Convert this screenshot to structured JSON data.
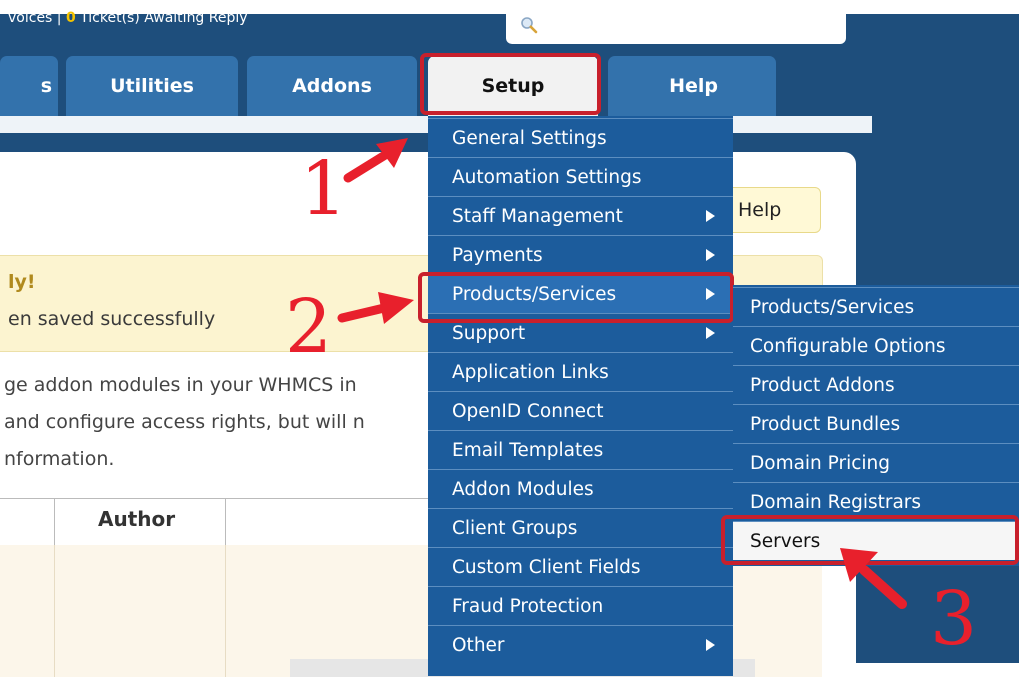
{
  "topbar": {
    "invoices_fragment": "voices | ",
    "tickets_count": "0",
    "tickets_text": " Ticket(s) Awaiting Reply"
  },
  "nav": {
    "tabs": [
      {
        "label": "s"
      },
      {
        "label": "Utilities"
      },
      {
        "label": "Addons"
      },
      {
        "label": "Setup"
      },
      {
        "label": "Help"
      }
    ]
  },
  "content": {
    "help_label": "Help",
    "success_title": "ly!",
    "success_message": "en saved successfully",
    "description_lines": [
      "ge addon modules in your WHMCS in",
      "and configure access rights, but will n",
      "nformation."
    ],
    "table_headers": {
      "author": "Author"
    }
  },
  "setup_menu": {
    "items": [
      {
        "label": "General Settings",
        "submenu": false
      },
      {
        "label": "Automation Settings",
        "submenu": false
      },
      {
        "label": "Staff Management",
        "submenu": true
      },
      {
        "label": "Payments",
        "submenu": true
      },
      {
        "label": "Products/Services",
        "submenu": true,
        "active": true
      },
      {
        "label": "Support",
        "submenu": true
      },
      {
        "label": "Application Links",
        "submenu": false
      },
      {
        "label": "OpenID Connect",
        "submenu": false
      },
      {
        "label": "Email Templates",
        "submenu": false
      },
      {
        "label": "Addon Modules",
        "submenu": false
      },
      {
        "label": "Client Groups",
        "submenu": false
      },
      {
        "label": "Custom Client Fields",
        "submenu": false
      },
      {
        "label": "Fraud Protection",
        "submenu": false
      },
      {
        "label": "Other",
        "submenu": true
      }
    ]
  },
  "products_submenu": {
    "items": [
      {
        "label": "Products/Services"
      },
      {
        "label": "Configurable Options"
      },
      {
        "label": "Product Addons"
      },
      {
        "label": "Product Bundles"
      },
      {
        "label": "Domain Pricing"
      },
      {
        "label": "Domain Registrars"
      },
      {
        "label": "Servers",
        "selected": true
      }
    ]
  },
  "annotations": {
    "step_1": "1",
    "step_2": "2",
    "step_3": "3",
    "highlight_color": "#c8202c"
  },
  "colors": {
    "nav_blue": "#3372ac",
    "menu_blue": "#1c5c9c",
    "frame_navy": "#1e4e7c",
    "alert_yellow": "#fcf4d0",
    "ticket_count": "#f5c400"
  }
}
